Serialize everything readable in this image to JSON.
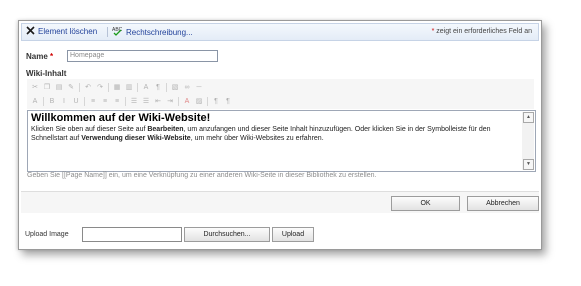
{
  "toolbar_top": {
    "delete_label": "Element löschen",
    "spelling_label": "Rechtschreibung...",
    "required_star": "*",
    "required_note": " zeigt ein erforderliches Feld an"
  },
  "form": {
    "name_label": "Name",
    "name_required_star": "*",
    "name_value": "Homepage",
    "wiki_label": "Wiki-Inhalt"
  },
  "editor": {
    "toolbar_row1": [
      "cut-icon",
      "copy-icon",
      "paste-icon",
      "paste-plain-icon",
      "undo-icon",
      "redo-icon",
      "table-icon",
      "insert-table-icon",
      "font-icon",
      "style-icon",
      "image-icon",
      "link-icon",
      "hr-icon"
    ],
    "toolbar_row2": [
      "font-size-icon",
      "bold-icon",
      "italic-icon",
      "underline-icon",
      "align-left-icon",
      "align-center-icon",
      "align-right-icon",
      "numbered-list-icon",
      "bullet-list-icon",
      "outdent-icon",
      "indent-icon",
      "text-color-icon",
      "background-color-icon",
      "ltr-icon",
      "rtl-icon"
    ],
    "title": "Willkommen auf der Wiki-Website!",
    "para_1": "Klicken Sie oben auf dieser Seite auf ",
    "para_bold_1": "Bearbeiten",
    "para_2": ", um anzufangen und dieser Seite Inhalt hinzuzufügen. Oder klicken Sie in der Symbolleiste für den Schnellstart auf ",
    "para_bold_2": "Verwendung dieser Wiki-Website",
    "para_3": ", um mehr über Wiki-Websites zu erfahren."
  },
  "hint": "Geben Sie [[Page Name]] ein, um eine Verknüpfung zu einer anderen Wiki-Seite in dieser Bibliothek zu erstellen.",
  "buttons": {
    "ok": "OK",
    "cancel": "Abbrechen",
    "browse": "Durchsuchen...",
    "upload": "Upload"
  },
  "upload": {
    "label": "Upload Image",
    "value": ""
  }
}
